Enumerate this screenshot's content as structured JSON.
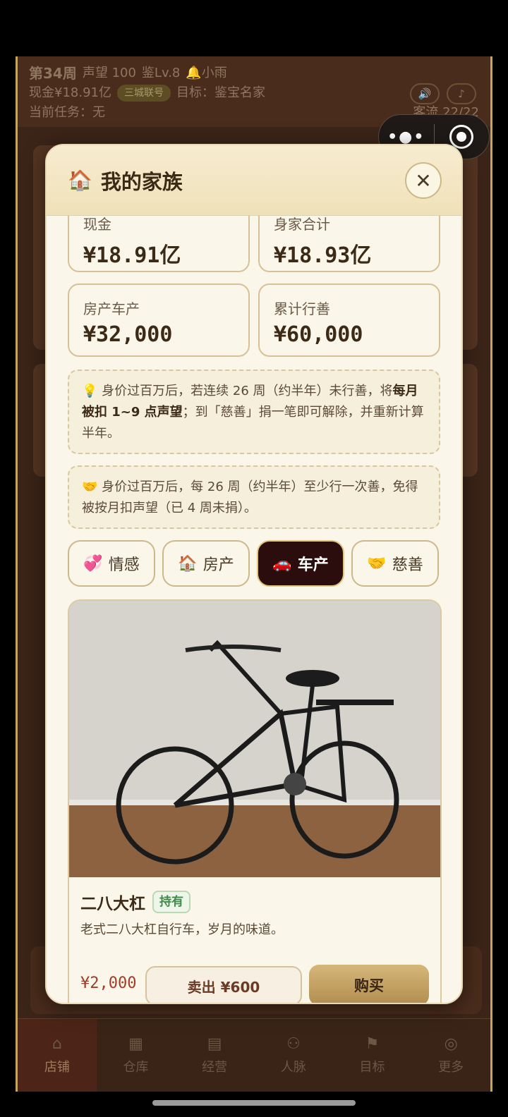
{
  "hud": {
    "week": "第34周",
    "reputation": "声望 100",
    "appraisal_level": "鉴Lv.8",
    "weather": "🔔小雨",
    "cash": "现金¥18.91亿",
    "alliance_badge": "三城联号",
    "goal": "目标：鉴宝名家",
    "task": "当前任务：无",
    "visitors": "客流 22/22"
  },
  "modal": {
    "title": "我的家族",
    "stats": [
      {
        "label": "现金",
        "value": "¥18.91亿"
      },
      {
        "label": "身家合计",
        "value": "¥18.93亿"
      },
      {
        "label": "房产车产",
        "value": "¥32,000"
      },
      {
        "label": "累计行善",
        "value": "¥60,000"
      }
    ],
    "note1": {
      "icon": "💡",
      "text_a": " 身价过百万后，若连续 26 周（约半年）未行善，将",
      "bold": "每月被扣 1~9 点声望",
      "text_b": "；到「慈善」捐一笔即可解除，并重新计算半年。"
    },
    "note2": {
      "icon": "🤝",
      "text": " 身价过百万后，每 26 周（约半年）至少行一次善，免得被按月扣声望（已 4 周未捐）。"
    },
    "tabs": [
      {
        "icon": "💞",
        "label": "情感"
      },
      {
        "icon": "🏠",
        "label": "房产"
      },
      {
        "icon": "🚗",
        "label": "车产"
      },
      {
        "icon": "🤝",
        "label": "慈善"
      }
    ],
    "item": {
      "name": "二八大杠",
      "status": "持有",
      "desc": "老式二八大杠自行车，岁月的味道。",
      "price": "¥2,000",
      "sell": "卖出 ¥600",
      "buy": "购买"
    }
  },
  "tabbar": [
    {
      "label": "店铺",
      "icon": "shop-icon"
    },
    {
      "label": "仓库",
      "icon": "warehouse-icon"
    },
    {
      "label": "经营",
      "icon": "business-icon"
    },
    {
      "label": "人脉",
      "icon": "people-icon"
    },
    {
      "label": "目标",
      "icon": "goal-icon"
    },
    {
      "label": "更多",
      "icon": "more-icon"
    }
  ],
  "colors": {
    "accent": "#c7a560",
    "active_tab": "#2b0d0d",
    "price": "#a33b26"
  }
}
